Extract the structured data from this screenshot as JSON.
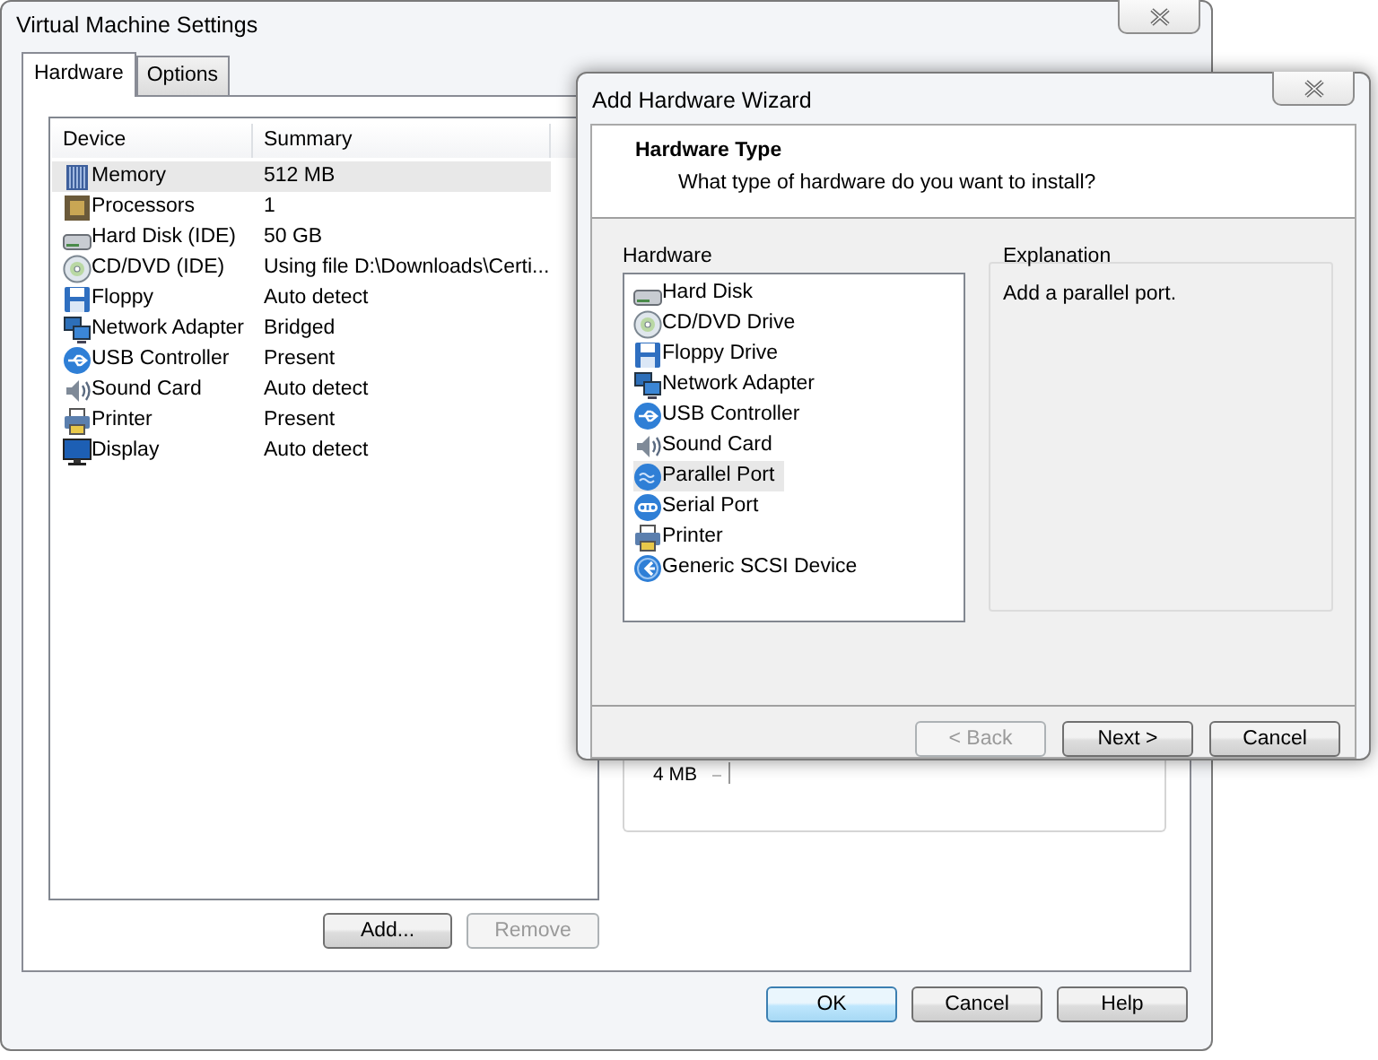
{
  "main_window": {
    "title": "Virtual Machine Settings",
    "tabs": [
      {
        "label": "Hardware",
        "selected": true
      },
      {
        "label": "Options",
        "selected": false
      }
    ],
    "device_table": {
      "columns": [
        "Device",
        "Summary"
      ],
      "rows": [
        {
          "kind": "memory",
          "device": "Memory",
          "summary": "512 MB",
          "selected": true
        },
        {
          "kind": "processor",
          "device": "Processors",
          "summary": "1",
          "selected": false
        },
        {
          "kind": "harddisk",
          "device": "Hard Disk (IDE)",
          "summary": "50 GB",
          "selected": false
        },
        {
          "kind": "cdrom",
          "device": "CD/DVD (IDE)",
          "summary": "Using file D:\\Downloads\\Certi...",
          "selected": false
        },
        {
          "kind": "floppy",
          "device": "Floppy",
          "summary": "Auto detect",
          "selected": false
        },
        {
          "kind": "network",
          "device": "Network Adapter",
          "summary": "Bridged",
          "selected": false
        },
        {
          "kind": "usb",
          "device": "USB Controller",
          "summary": "Present",
          "selected": false
        },
        {
          "kind": "sound",
          "device": "Sound Card",
          "summary": "Auto detect",
          "selected": false
        },
        {
          "kind": "printer",
          "device": "Printer",
          "summary": "Present",
          "selected": false
        },
        {
          "kind": "display",
          "device": "Display",
          "summary": "Auto detect",
          "selected": false
        }
      ]
    },
    "list_buttons": [
      {
        "label": "Add...",
        "disabled": false
      },
      {
        "label": "Remove",
        "disabled": true
      }
    ],
    "memory_panel": {
      "label": "4 MB"
    },
    "buttons": [
      {
        "label": "OK",
        "default": true
      },
      {
        "label": "Cancel",
        "default": false
      },
      {
        "label": "Help",
        "default": false
      }
    ]
  },
  "wizard": {
    "title": "Add Hardware Wizard",
    "heading": "Hardware Type",
    "subtitle": "What type of hardware do you want to install?",
    "hardware_label": "Hardware",
    "hardware_items": [
      {
        "kind": "harddisk",
        "label": "Hard Disk",
        "selected": false
      },
      {
        "kind": "cdrom",
        "label": "CD/DVD Drive",
        "selected": false
      },
      {
        "kind": "floppy",
        "label": "Floppy Drive",
        "selected": false
      },
      {
        "kind": "network",
        "label": "Network Adapter",
        "selected": false
      },
      {
        "kind": "usb",
        "label": "USB Controller",
        "selected": false
      },
      {
        "kind": "sound",
        "label": "Sound Card",
        "selected": false
      },
      {
        "kind": "parallel",
        "label": "Parallel Port",
        "selected": true
      },
      {
        "kind": "serial",
        "label": "Serial Port",
        "selected": false
      },
      {
        "kind": "printer",
        "label": "Printer",
        "selected": false
      },
      {
        "kind": "scsi",
        "label": "Generic SCSI Device",
        "selected": false
      }
    ],
    "explanation_label": "Explanation",
    "explanation": "Add a parallel port.",
    "buttons": [
      {
        "label": "< Back",
        "disabled": true,
        "default": false
      },
      {
        "label": "Next >",
        "disabled": false,
        "default": false
      },
      {
        "label": "Cancel",
        "disabled": false,
        "default": false
      }
    ]
  }
}
